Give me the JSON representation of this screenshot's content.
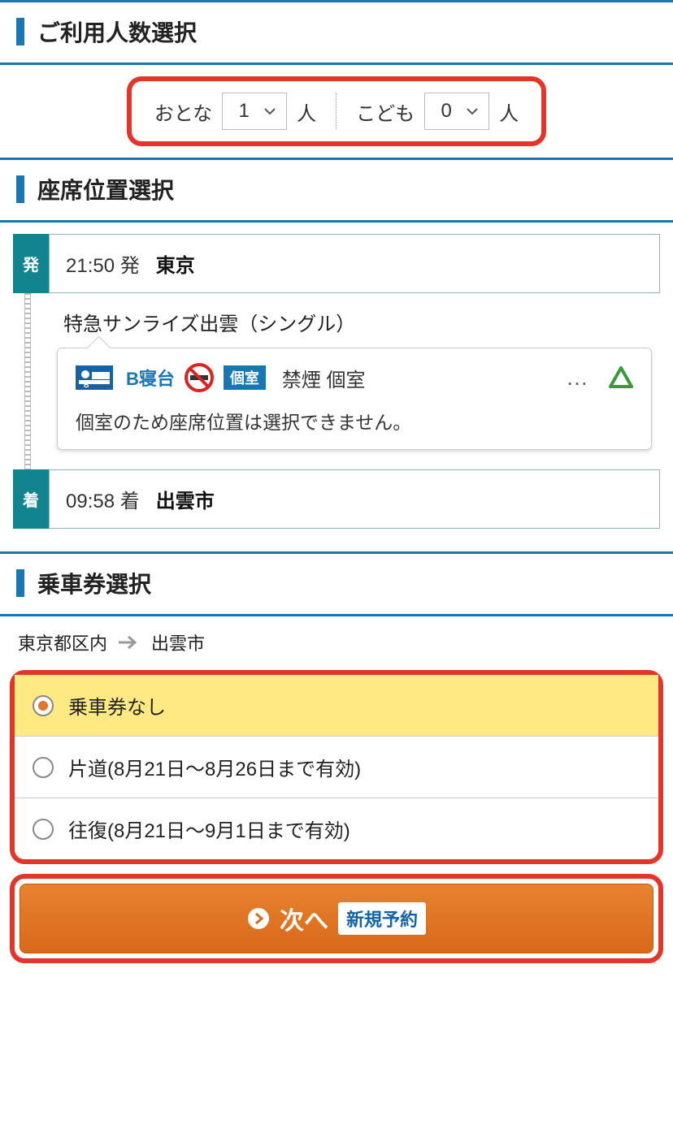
{
  "sections": {
    "passengers_title": "ご利用人数選択",
    "seat_title": "座席位置選択",
    "ticket_title": "乗車券選択"
  },
  "passengers": {
    "adult_label": "おとな",
    "adult_value": "1",
    "unit": "人",
    "child_label": "こども",
    "child_value": "0"
  },
  "route": {
    "dep_badge": "発",
    "dep_time": "21:50 発",
    "dep_station": "東京",
    "arr_badge": "着",
    "arr_time": "09:58 着",
    "arr_station": "出雲市",
    "train_name": "特急サンライズ出雲（シングル）",
    "berth_label": "B寝台",
    "room_tag": "個室",
    "seat_text": "禁煙 個室",
    "dots": "…",
    "note": "個室のため座席位置は選択できません。"
  },
  "ticket": {
    "from": "東京都区内",
    "to": "出雲市",
    "options": [
      "乗車券なし",
      "片道(8月21日～8月26日まで有効)",
      "往復(8月21日～9月1日まで有効)"
    ]
  },
  "next": {
    "label": "次へ",
    "tag": "新規予約"
  }
}
